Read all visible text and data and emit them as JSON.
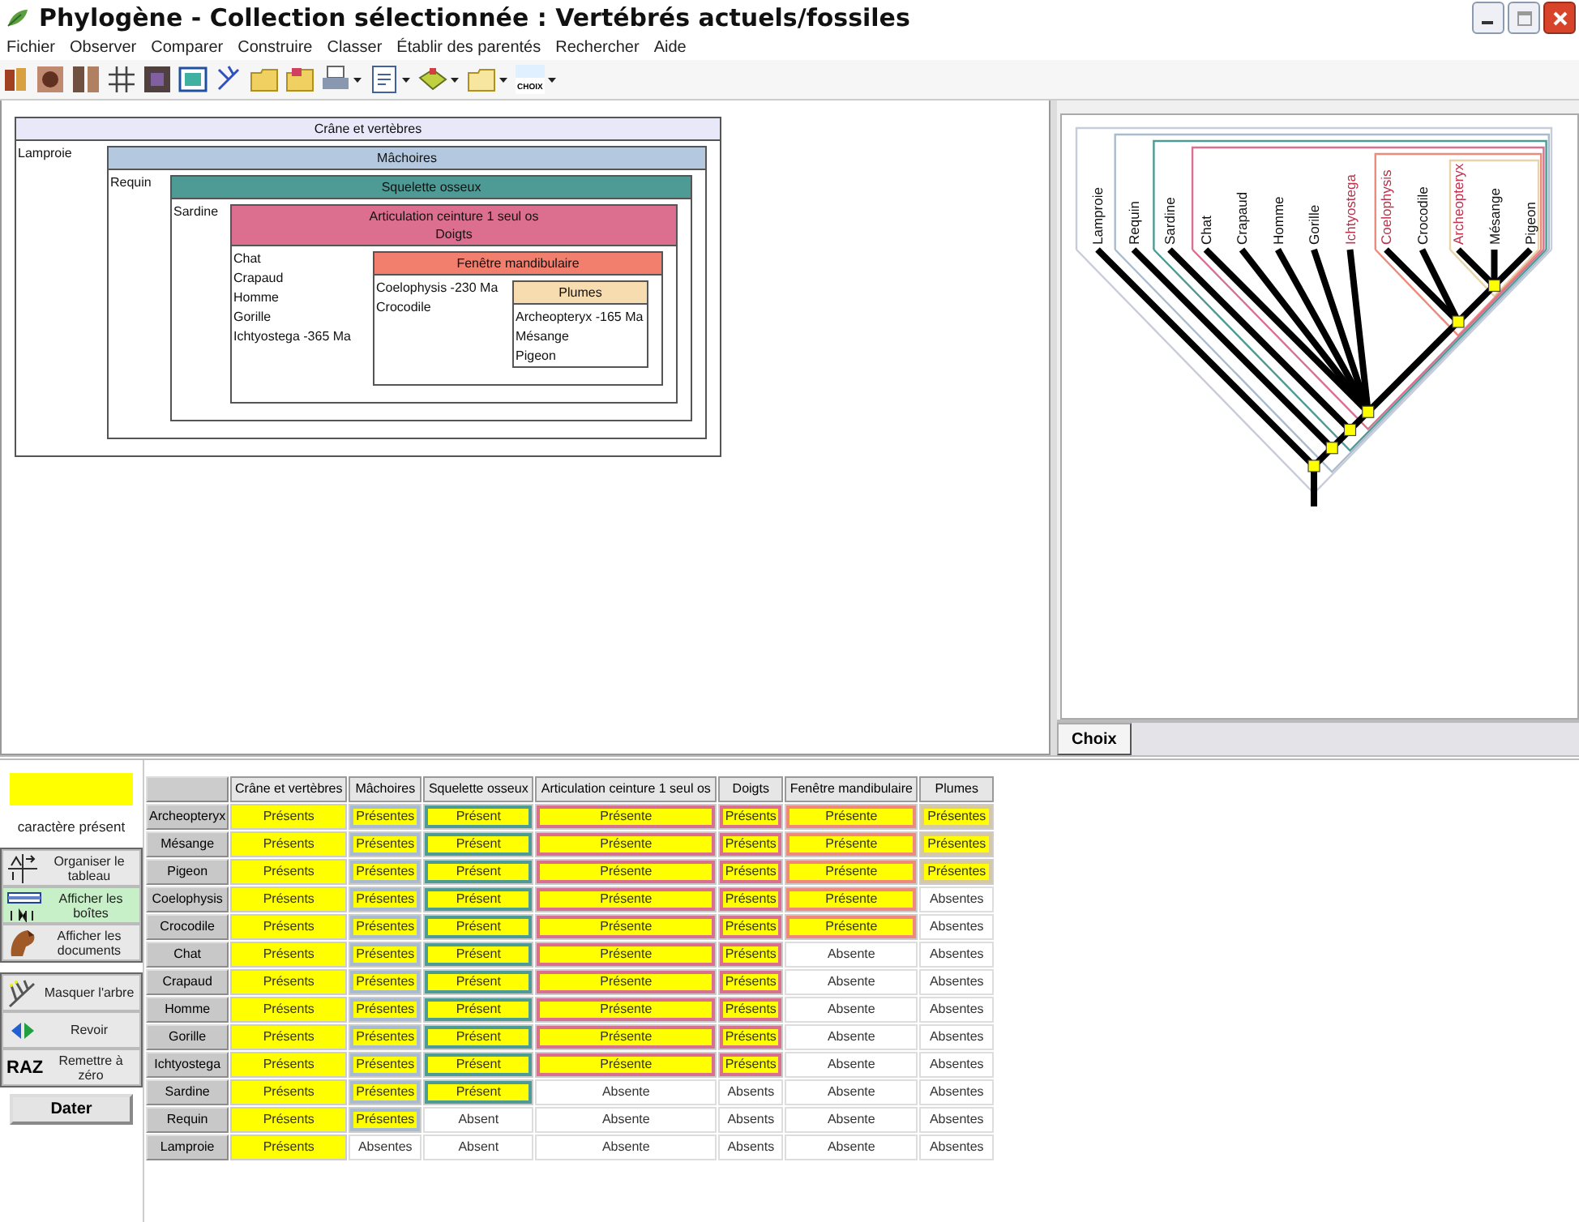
{
  "window": {
    "title": "Phylogène - Collection sélectionnée : Vertébrés actuels/fossiles"
  },
  "menu": [
    "Fichier",
    "Observer",
    "Comparer",
    "Construire",
    "Classer",
    "Établir des parentés",
    "Rechercher",
    "Aide"
  ],
  "toolbar": {
    "choice_label": "CHOIX"
  },
  "boxes": {
    "headers": [
      "Crâne et vertèbres"
    ],
    "color": "#e8e8f8",
    "taxa": [
      "Lamproie"
    ],
    "child": {
      "headers": [
        "Mâchoires"
      ],
      "color": "#b4c8e0",
      "taxa": [
        "Requin"
      ],
      "child": {
        "headers": [
          "Squelette osseux"
        ],
        "color": "#4e9a94",
        "taxa": [
          "Sardine"
        ],
        "child": {
          "headers": [
            "Articulation ceinture 1 seul os",
            "Doigts"
          ],
          "color": "#dc6e90",
          "taxa": [
            "Chat",
            "Crapaud",
            "Homme",
            "Gorille",
            "Ichtyostega -365 Ma"
          ],
          "child": {
            "headers": [
              "Fenêtre mandibulaire"
            ],
            "color": "#f27e6e",
            "taxa": [
              "Coelophysis -230 Ma",
              "Crocodile"
            ],
            "child": {
              "headers": [
                "Plumes"
              ],
              "color": "#f6dcae",
              "taxa": [
                "Archeopteryx -165 Ma",
                "Mésange",
                "Pigeon"
              ]
            }
          }
        }
      }
    }
  },
  "tree": {
    "color": "#c8ccd8",
    "children": [
      {
        "name": "Lamproie",
        "fossil": false
      },
      {
        "color": "#a9bccf",
        "children": [
          {
            "name": "Requin",
            "fossil": false
          },
          {
            "color": "#4e9a94",
            "children": [
              {
                "name": "Sardine",
                "fossil": false
              },
              {
                "color": "#d9708f",
                "children": [
                  {
                    "name": "Chat",
                    "fossil": false
                  },
                  {
                    "name": "Crapaud",
                    "fossil": false
                  },
                  {
                    "name": "Homme",
                    "fossil": false
                  },
                  {
                    "name": "Gorille",
                    "fossil": false
                  },
                  {
                    "name": "Ichtyostega",
                    "fossil": true
                  },
                  {
                    "color": "#ee8a7c",
                    "children": [
                      {
                        "name": "Coelophysis",
                        "fossil": true
                      },
                      {
                        "name": "Crocodile",
                        "fossil": false
                      },
                      {
                        "color": "#e8d4a8",
                        "children": [
                          {
                            "name": "Archeopteryx",
                            "fossil": true
                          },
                          {
                            "name": "Mésange",
                            "fossil": false
                          },
                          {
                            "name": "Pigeon",
                            "fossil": false
                          }
                        ]
                      }
                    ]
                  }
                ]
              }
            ]
          }
        ]
      }
    ]
  },
  "tree_tabs": [
    {
      "label": "Choix",
      "selected": true
    }
  ],
  "legend": {
    "label": "caractère présent"
  },
  "view_buttons": [
    {
      "label": "Organiser le tableau",
      "selected": false
    },
    {
      "label": "Afficher les boîtes",
      "selected": true
    },
    {
      "label": "Afficher les documents",
      "selected": false
    }
  ],
  "action_buttons": [
    {
      "label": "Masquer l'arbre"
    },
    {
      "label": "Revoir"
    },
    {
      "label": "Remettre à zéro",
      "icon_text": "RAZ"
    }
  ],
  "date_button": "Dater",
  "table": {
    "columns": [
      {
        "label": "Crâne et vertèbres"
      },
      {
        "label": "Mâchoires",
        "color": "#a9bccf"
      },
      {
        "label": "Squelette osseux",
        "color": "#4e9a94"
      },
      {
        "label": "Articulation ceinture 1 seul os",
        "color": "#d9708f"
      },
      {
        "label": "Doigts",
        "color": "#d9708f"
      },
      {
        "label": "Fenêtre mandibulaire",
        "color": "#ee8a7c"
      },
      {
        "label": "Plumes",
        "color": "#d8c8a0"
      }
    ],
    "rows": [
      {
        "name": "Archeopteryx",
        "cells": [
          {
            "text": "Présents",
            "present": true
          },
          {
            "text": "Présentes",
            "present": true
          },
          {
            "text": "Présent",
            "present": true
          },
          {
            "text": "Présente",
            "present": true
          },
          {
            "text": "Présents",
            "present": true
          },
          {
            "text": "Présente",
            "present": true
          },
          {
            "text": "Présentes",
            "present": true
          }
        ]
      },
      {
        "name": "Mésange",
        "cells": [
          {
            "text": "Présents",
            "present": true
          },
          {
            "text": "Présentes",
            "present": true
          },
          {
            "text": "Présent",
            "present": true
          },
          {
            "text": "Présente",
            "present": true
          },
          {
            "text": "Présents",
            "present": true
          },
          {
            "text": "Présente",
            "present": true
          },
          {
            "text": "Présentes",
            "present": true
          }
        ]
      },
      {
        "name": "Pigeon",
        "cells": [
          {
            "text": "Présents",
            "present": true
          },
          {
            "text": "Présentes",
            "present": true
          },
          {
            "text": "Présent",
            "present": true
          },
          {
            "text": "Présente",
            "present": true
          },
          {
            "text": "Présents",
            "present": true
          },
          {
            "text": "Présente",
            "present": true
          },
          {
            "text": "Présentes",
            "present": true
          }
        ]
      },
      {
        "name": "Coelophysis",
        "cells": [
          {
            "text": "Présents",
            "present": true
          },
          {
            "text": "Présentes",
            "present": true
          },
          {
            "text": "Présent",
            "present": true
          },
          {
            "text": "Présente",
            "present": true
          },
          {
            "text": "Présents",
            "present": true
          },
          {
            "text": "Présente",
            "present": true
          },
          {
            "text": "Absentes",
            "present": false
          }
        ]
      },
      {
        "name": "Crocodile",
        "cells": [
          {
            "text": "Présents",
            "present": true
          },
          {
            "text": "Présentes",
            "present": true
          },
          {
            "text": "Présent",
            "present": true
          },
          {
            "text": "Présente",
            "present": true
          },
          {
            "text": "Présents",
            "present": true
          },
          {
            "text": "Présente",
            "present": true
          },
          {
            "text": "Absentes",
            "present": false
          }
        ]
      },
      {
        "name": "Chat",
        "cells": [
          {
            "text": "Présents",
            "present": true
          },
          {
            "text": "Présentes",
            "present": true
          },
          {
            "text": "Présent",
            "present": true
          },
          {
            "text": "Présente",
            "present": true
          },
          {
            "text": "Présents",
            "present": true
          },
          {
            "text": "Absente",
            "present": false
          },
          {
            "text": "Absentes",
            "present": false
          }
        ]
      },
      {
        "name": "Crapaud",
        "cells": [
          {
            "text": "Présents",
            "present": true
          },
          {
            "text": "Présentes",
            "present": true
          },
          {
            "text": "Présent",
            "present": true
          },
          {
            "text": "Présente",
            "present": true
          },
          {
            "text": "Présents",
            "present": true
          },
          {
            "text": "Absente",
            "present": false
          },
          {
            "text": "Absentes",
            "present": false
          }
        ]
      },
      {
        "name": "Homme",
        "cells": [
          {
            "text": "Présents",
            "present": true
          },
          {
            "text": "Présentes",
            "present": true
          },
          {
            "text": "Présent",
            "present": true
          },
          {
            "text": "Présente",
            "present": true
          },
          {
            "text": "Présents",
            "present": true
          },
          {
            "text": "Absente",
            "present": false
          },
          {
            "text": "Absentes",
            "present": false
          }
        ]
      },
      {
        "name": "Gorille",
        "cells": [
          {
            "text": "Présents",
            "present": true
          },
          {
            "text": "Présentes",
            "present": true
          },
          {
            "text": "Présent",
            "present": true
          },
          {
            "text": "Présente",
            "present": true
          },
          {
            "text": "Présents",
            "present": true
          },
          {
            "text": "Absente",
            "present": false
          },
          {
            "text": "Absentes",
            "present": false
          }
        ]
      },
      {
        "name": "Ichtyostega",
        "cells": [
          {
            "text": "Présents",
            "present": true
          },
          {
            "text": "Présentes",
            "present": true
          },
          {
            "text": "Présent",
            "present": true
          },
          {
            "text": "Présente",
            "present": true
          },
          {
            "text": "Présents",
            "present": true
          },
          {
            "text": "Absente",
            "present": false
          },
          {
            "text": "Absentes",
            "present": false
          }
        ]
      },
      {
        "name": "Sardine",
        "cells": [
          {
            "text": "Présents",
            "present": true
          },
          {
            "text": "Présentes",
            "present": true
          },
          {
            "text": "Présent",
            "present": true
          },
          {
            "text": "Absente",
            "present": false
          },
          {
            "text": "Absents",
            "present": false
          },
          {
            "text": "Absente",
            "present": false
          },
          {
            "text": "Absentes",
            "present": false
          }
        ]
      },
      {
        "name": "Requin",
        "cells": [
          {
            "text": "Présents",
            "present": true
          },
          {
            "text": "Présentes",
            "present": true
          },
          {
            "text": "Absent",
            "present": false
          },
          {
            "text": "Absente",
            "present": false
          },
          {
            "text": "Absents",
            "present": false
          },
          {
            "text": "Absente",
            "present": false
          },
          {
            "text": "Absentes",
            "present": false
          }
        ]
      },
      {
        "name": "Lamproie",
        "cells": [
          {
            "text": "Présents",
            "present": true
          },
          {
            "text": "Absentes",
            "present": false
          },
          {
            "text": "Absent",
            "present": false
          },
          {
            "text": "Absente",
            "present": false
          },
          {
            "text": "Absents",
            "present": false
          },
          {
            "text": "Absente",
            "present": false
          },
          {
            "text": "Absentes",
            "present": false
          }
        ]
      }
    ]
  }
}
